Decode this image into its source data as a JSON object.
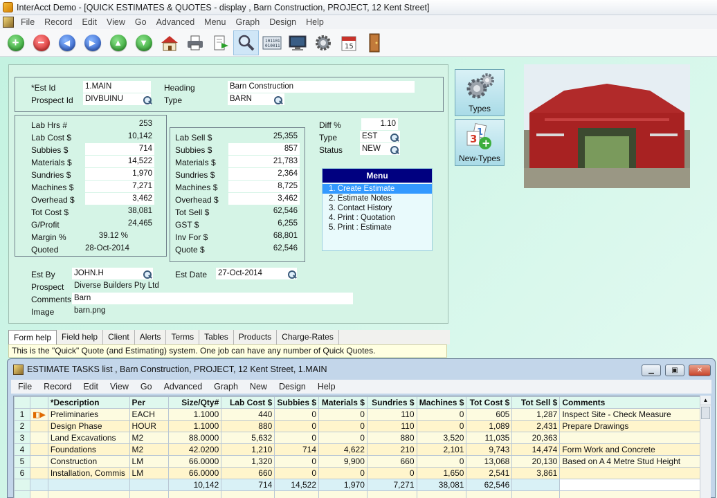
{
  "window": {
    "title": "InterAcct Demo - [QUICK ESTIMATES & QUOTES - display , Barn Construction, PROJECT, 12 Kent Street]"
  },
  "menu": [
    "File",
    "Record",
    "Edit",
    "View",
    "Go",
    "Advanced",
    "Menu",
    "Graph",
    "Design",
    "Help"
  ],
  "toolbar": [
    "add-icon",
    "delete-icon",
    "previous-record-icon",
    "next-record-icon",
    "move-up-icon",
    "move-down-icon",
    "home-icon",
    "print-icon",
    "export-icon",
    "search-icon",
    "calculator-icon",
    "monitor-icon",
    "settings-icon",
    "calendar-icon",
    "exit-door-icon"
  ],
  "header": {
    "est_id_label": "*Est Id",
    "est_id": "1.MAIN",
    "heading_label": "Heading",
    "heading": "Barn Construction",
    "prospect_id_label": "Prospect Id",
    "prospect_id": "DIVBUINU",
    "type_label": "Type",
    "type": "BARN"
  },
  "costs": {
    "lab_hrs_label": "Lab Hrs #",
    "lab_hrs": "253",
    "lab_cost_label": "Lab Cost $",
    "lab_cost": "10,142",
    "subbies_label": "Subbies  $",
    "subbies": "714",
    "materials_label": "Materials $",
    "materials": "14,522",
    "sundries_label": "Sundries  $",
    "sundries": "1,970",
    "machines_label": "Machines $",
    "machines": "7,271",
    "overhead_label": "Overhead $",
    "overhead": "3,462",
    "tot_cost_label": "Tot Cost $",
    "tot_cost": "38,081",
    "gprofit_label": "G/Profit",
    "gprofit": "24,465",
    "margin_label": "Margin %",
    "margin": "39.12 %",
    "quoted_label": "Quoted",
    "quoted": "28-Oct-2014"
  },
  "sell": {
    "lab_sell_label": "Lab Sell $",
    "lab_sell": "25,355",
    "subbies_label": "Subbies  $",
    "subbies": "857",
    "materials_label": "Materials $",
    "materials": "21,783",
    "sundries_label": "Sundries  $",
    "sundries": "2,364",
    "machines_label": "Machines $",
    "machines": "8,725",
    "overhead_label": "Overhead $",
    "overhead": "3,462",
    "tot_sell_label": "Tot Sell $",
    "tot_sell": "62,546",
    "gst_label": "GST  $",
    "gst": "6,255",
    "inv_for_label": "Inv For $",
    "inv_for": "68,801",
    "quote_label": "Quote $",
    "quote": "62,546"
  },
  "status": {
    "diff_label": "Diff %",
    "diff": "1.10",
    "type_label": "Type",
    "type": "EST",
    "status_label": "Status",
    "status": "NEW"
  },
  "actions": {
    "title": "Menu",
    "items": [
      "1. Create Estimate",
      "2. Estimate Notes",
      "3. Contact History",
      "4. Print : Quotation",
      "5. Print : Estimate"
    ]
  },
  "footer": {
    "est_by_label": "Est By",
    "est_by": "JOHN.H",
    "est_date_label": "Est Date",
    "est_date": "27-Oct-2014",
    "prospect_label": "Prospect",
    "prospect": "Diverse Builders Pty Ltd",
    "comments_label": "Comments",
    "comments": "Barn",
    "image_label": "Image",
    "image": "barn.png"
  },
  "side_buttons": {
    "types": "Types",
    "new_types": "New-Types"
  },
  "tabs": [
    "Form help",
    "Field help",
    "Client",
    "Alerts",
    "Terms",
    "Tables",
    "Products",
    "Charge-Rates"
  ],
  "help_text": "This is the \"Quick\" Quote (and Estimating) system.  One job can have any number of Quick Quotes.",
  "subwindow": {
    "title": "ESTIMATE TASKS list , Barn Construction, PROJECT, 12 Kent Street, 1.MAIN",
    "menu": [
      "File",
      "Record",
      "Edit",
      "View",
      "Go",
      "Advanced",
      "Graph",
      "New",
      "Design",
      "Help"
    ],
    "columns": [
      "*Description",
      "Per",
      "Size/Qty#",
      "Lab Cost $",
      "Subbies $",
      "Materials $",
      "Sundries $",
      "Machines $",
      "Tot Cost $",
      "Tot Sell $",
      "Comments"
    ],
    "rows": [
      [
        "1",
        "Preliminaries",
        "EACH",
        "1.1000",
        "440",
        "0",
        "0",
        "110",
        "0",
        "605",
        "1,287",
        "Inspect Site - Check Measure"
      ],
      [
        "2",
        "Design Phase",
        "HOUR",
        "1.1000",
        "880",
        "0",
        "0",
        "110",
        "0",
        "1,089",
        "2,431",
        "Prepare Drawings"
      ],
      [
        "3",
        "Land Excavations",
        "M2",
        "88.0000",
        "5,632",
        "0",
        "0",
        "880",
        "3,520",
        "11,035",
        "20,363",
        ""
      ],
      [
        "4",
        "Foundations",
        "M2",
        "42.0200",
        "1,210",
        "714",
        "4,622",
        "210",
        "2,101",
        "9,743",
        "14,474",
        "Form Work and Concrete"
      ],
      [
        "5",
        "Construction",
        "LM",
        "66.0000",
        "1,320",
        "0",
        "9,900",
        "660",
        "0",
        "13,068",
        "20,130",
        "Based on A 4 Metre Stud Height"
      ],
      [
        "6",
        "Installation, Commis",
        "LM",
        "66.0000",
        "660",
        "0",
        "0",
        "0",
        "1,650",
        "2,541",
        "3,861",
        ""
      ]
    ],
    "totals": [
      "",
      "",
      "",
      "",
      "10,142",
      "714",
      "14,522",
      "1,970",
      "7,271",
      "38,081",
      "62,546",
      ""
    ]
  }
}
